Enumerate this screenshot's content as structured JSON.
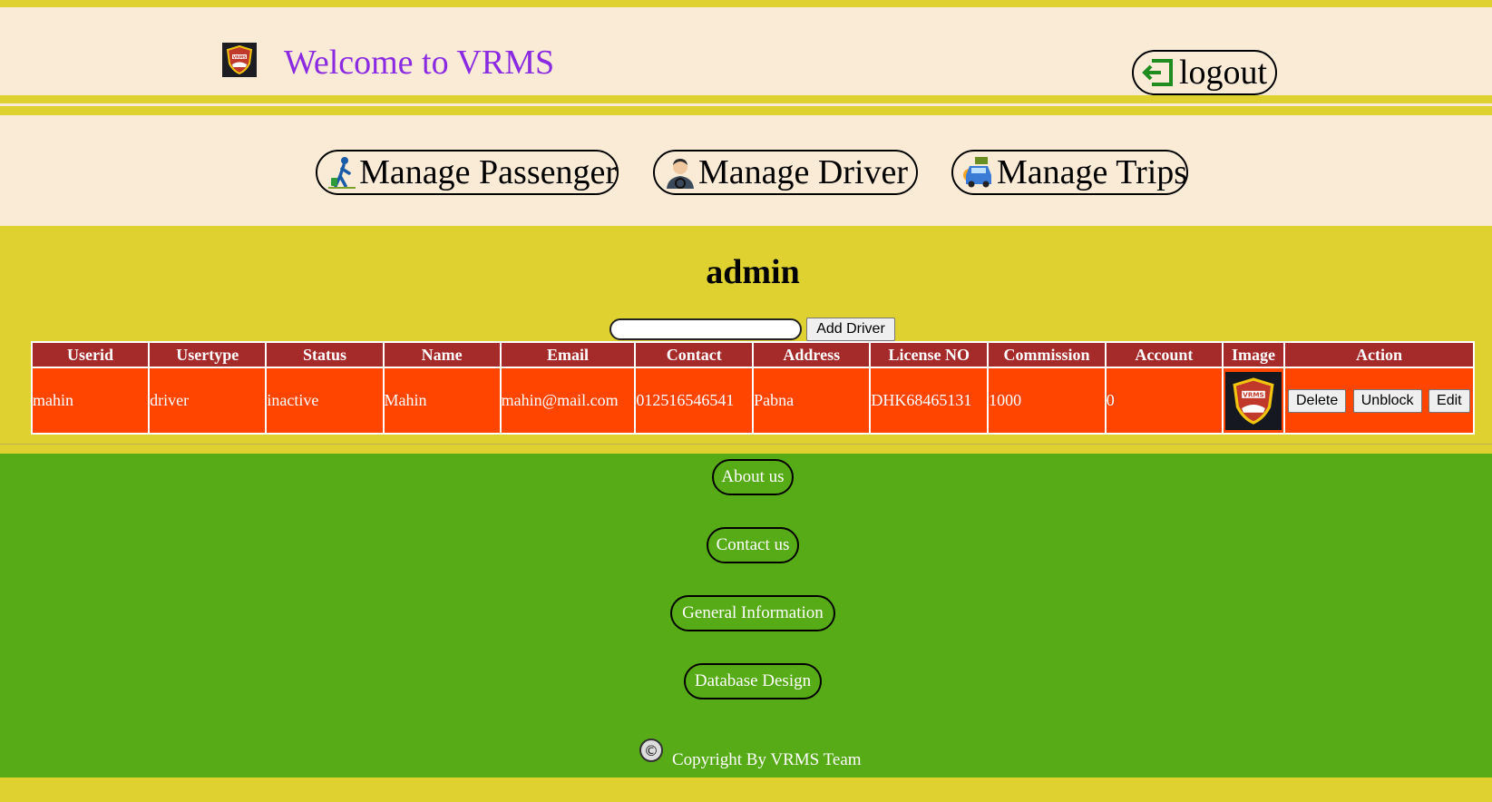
{
  "header": {
    "title": "Welcome to VRMS",
    "logout_label": "logout",
    "logo_text": "VRMS"
  },
  "nav": {
    "items": [
      {
        "label": "Manage Passenger",
        "icon": "passenger-icon"
      },
      {
        "label": "Manage Driver",
        "icon": "driver-icon"
      },
      {
        "label": "Manage Trips",
        "icon": "trips-icon"
      }
    ]
  },
  "main": {
    "heading": "admin",
    "search": {
      "value": "",
      "placeholder": ""
    },
    "add_driver_label": "Add Driver",
    "table": {
      "columns": [
        "Userid",
        "Usertype",
        "Status",
        "Name",
        "Email",
        "Contact",
        "Address",
        "License NO",
        "Commission",
        "Account",
        "Image",
        "Action"
      ],
      "rows": [
        {
          "userid": "mahin",
          "usertype": "driver",
          "status": "inactive",
          "name": "Mahin",
          "email": "mahin@mail.com",
          "contact": "012516546541",
          "address": "Pabna",
          "license": "DHK68465131",
          "commission": "1000",
          "account": "0",
          "image_text": "VRMS",
          "actions": [
            "Delete",
            "Unblock",
            "Edit"
          ]
        }
      ]
    }
  },
  "footer": {
    "links": [
      "About us",
      "Contact us",
      "General Information",
      "Database Design"
    ],
    "copyright_symbol": "©",
    "copyright": "Copyright By VRMS Team"
  },
  "colors": {
    "page_bg": "#dfd130",
    "header_bg": "#faebd7",
    "title": "#8a2be2",
    "table_header": "#a52a2a",
    "table_row": "#ff4500",
    "footer_bg": "#56ab16"
  }
}
